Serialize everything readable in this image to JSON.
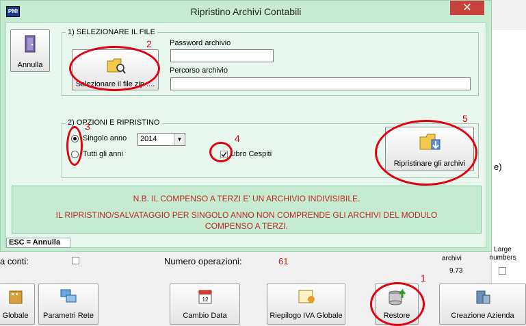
{
  "background": {
    "left_label": "a conti:",
    "operations_label": "Numero operazioni:",
    "operations_value": "61",
    "archives_label": "archivi",
    "archives_value": "9.73",
    "large_numbers_label": "Large numbers",
    "right_fragment": "e)",
    "toolbar": [
      {
        "label": "Globale",
        "icon": "building-icon"
      },
      {
        "label": "Parametri Rete",
        "icon": "network-icon"
      },
      {
        "label": "Cambio Data",
        "icon": "calendar-icon"
      },
      {
        "label": "Riepilogo IVA Globale",
        "icon": "calendar-report-icon"
      },
      {
        "label": "Restore",
        "icon": "database-restore-icon"
      },
      {
        "label": "Creazione Azienda",
        "icon": "company-create-icon"
      }
    ]
  },
  "dialog": {
    "app_icon": "PMI",
    "title": "Ripristino Archivi Contabili",
    "close_icon": "✕",
    "annulla_label": "Annulla",
    "section1_title": "1) SELEZIONARE IL FILE",
    "select_file_label": "Selezionare il file zip ....",
    "password_label": "Password archivio",
    "password_value": "",
    "path_label": "Percorso archivio",
    "path_value": "",
    "section2_title": "2) OPZIONI E RIPRISTINO",
    "radio_single_label": "Singolo anno",
    "radio_all_label": "Tutti gli  anni",
    "year_value": "2014",
    "libro_cespiti_label": "Libro Cespiti",
    "restore_button_label": "Ripristinare gli archivi",
    "note_line1": "N.B. IL COMPENSO A TERZI E' UN ARCHIVIO INDIVISIBILE.",
    "note_line2": "IL RIPRISTINO/SALVATAGGIO PER SINGOLO ANNO NON COMPRENDE GLI ARCHIVI DEL MODULO",
    "note_line3": "COMPENSO A TERZI.",
    "esc_label": "ESC = Annulla"
  },
  "annotations": [
    "1",
    "2",
    "3",
    "4",
    "5"
  ]
}
